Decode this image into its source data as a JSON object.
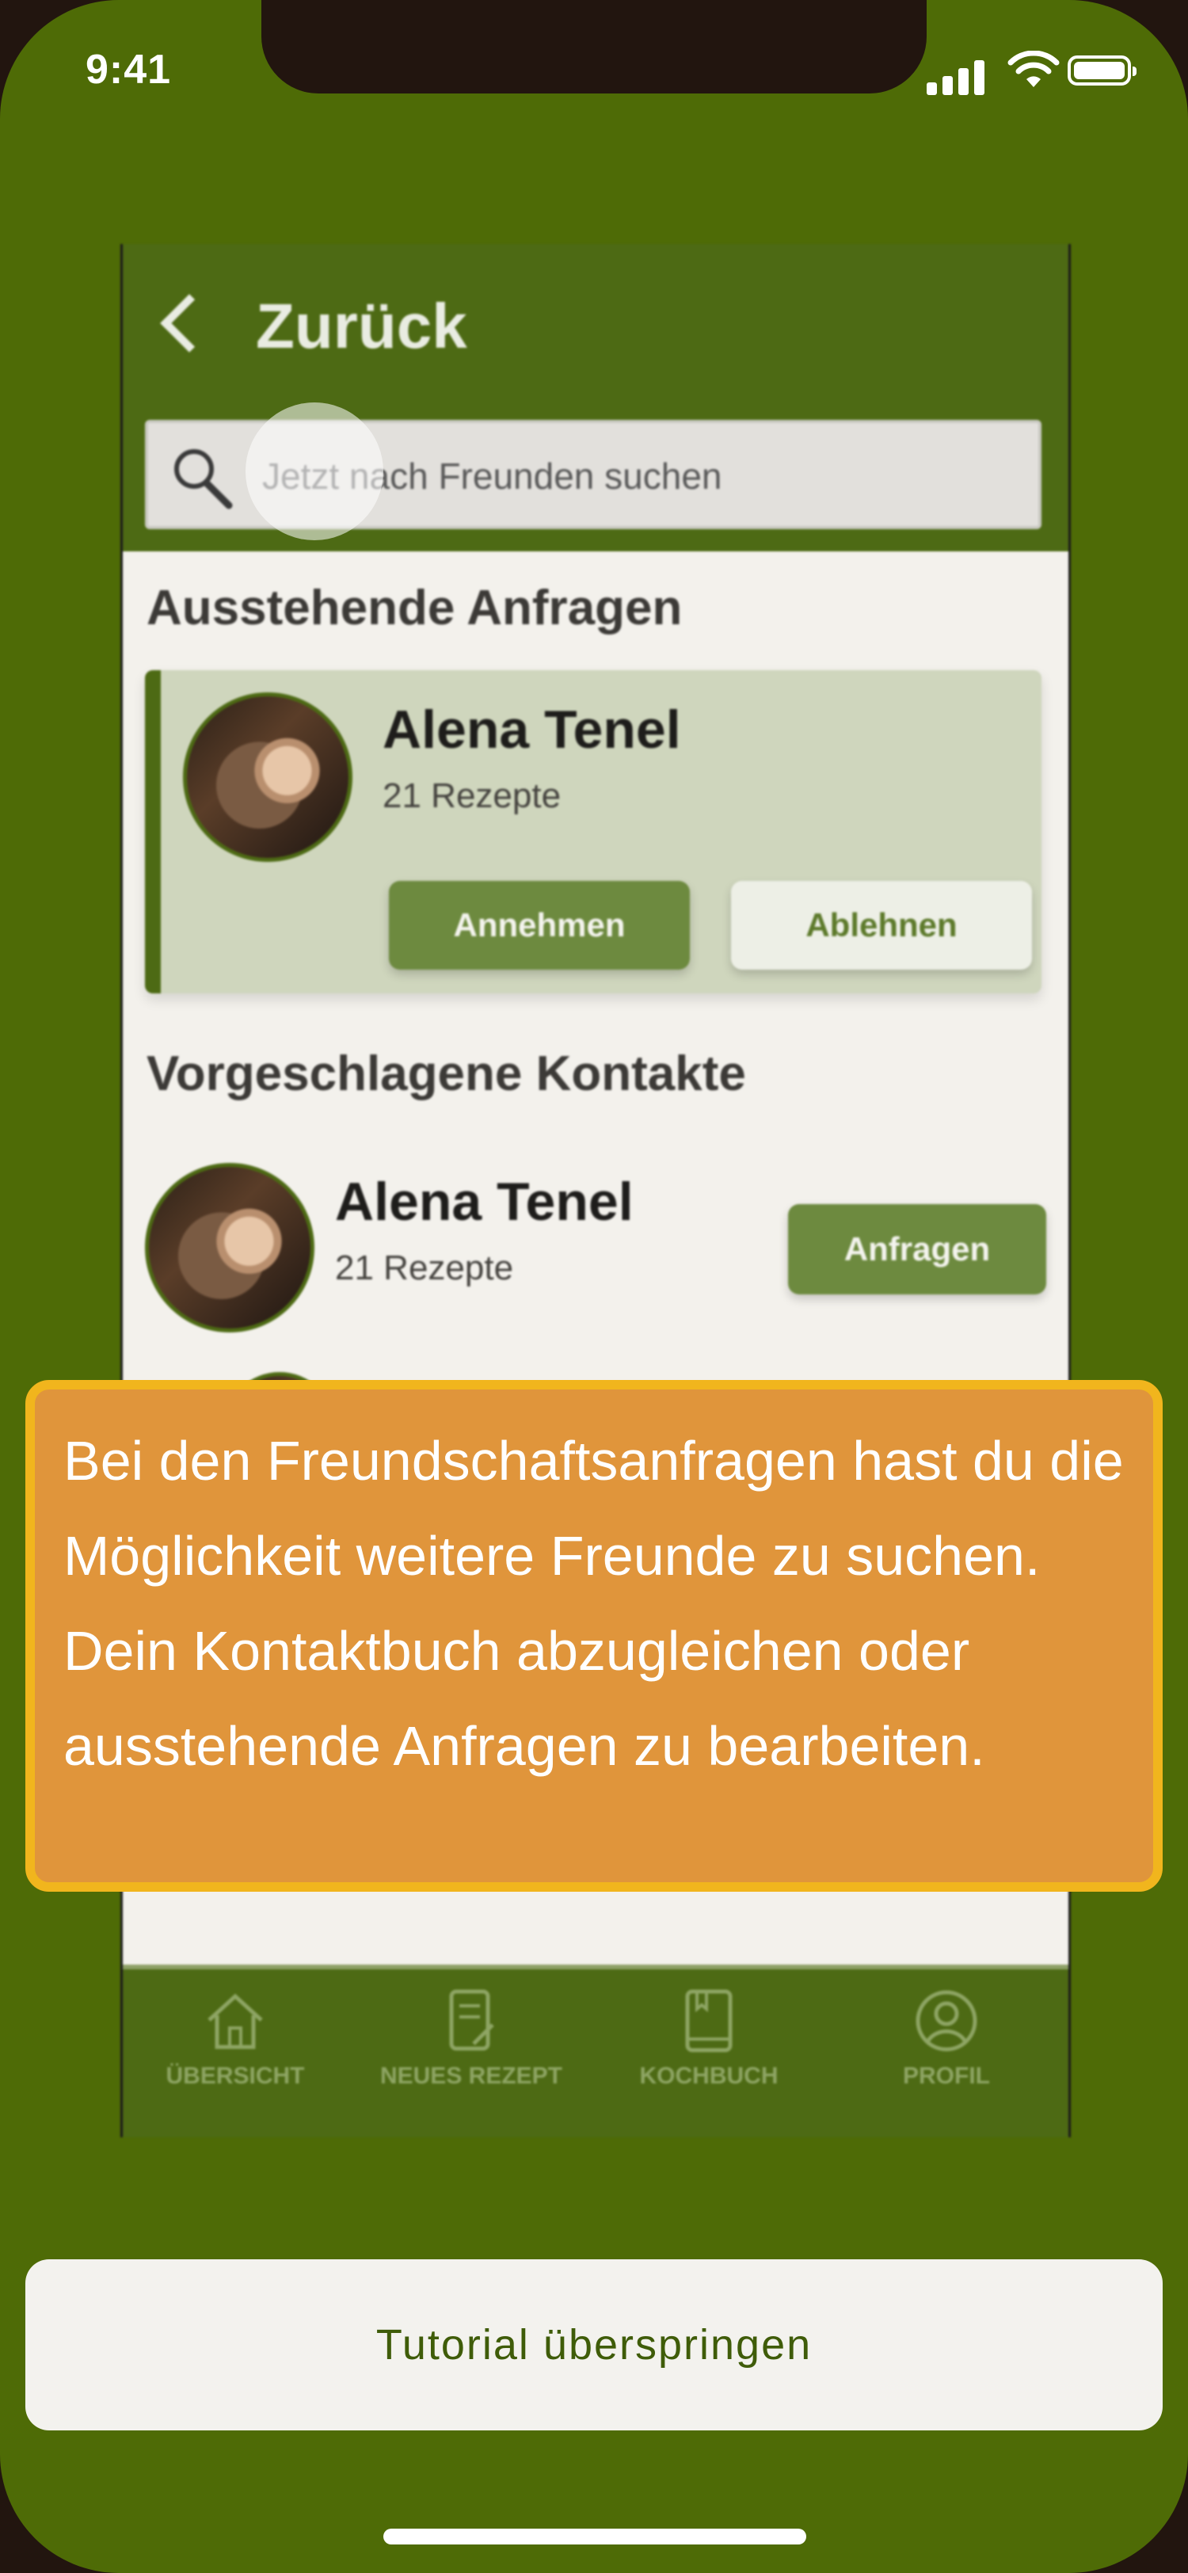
{
  "status_bar": {
    "time": "9:41"
  },
  "app_screen": {
    "back_label": "Zurück",
    "search": {
      "placeholder": "Jetzt nach Freunden suchen"
    },
    "pending": {
      "title": "Ausstehende Anfragen",
      "card": {
        "name": "Alena Tenel",
        "subtitle": "21 Rezepte",
        "accept_label": "Annehmen",
        "decline_label": "Ablehnen"
      }
    },
    "suggested": {
      "title": "Vorgeschlagene Kontakte",
      "item": {
        "name": "Alena Tenel",
        "subtitle": "21 Rezepte",
        "request_label": "Anfragen"
      }
    },
    "tabs": [
      {
        "label": "ÜBERSICHT",
        "icon": "house-icon"
      },
      {
        "label": "NEUES REZEPT",
        "icon": "recipe-edit-icon"
      },
      {
        "label": "KOCHBUCH",
        "icon": "cookbook-icon"
      },
      {
        "label": "PROFIL",
        "icon": "profile-icon"
      }
    ]
  },
  "tutorial": {
    "message": "Bei den Freundschaftsanfragen hast du die Möglichkeit weitere Freunde zu suchen. Dein Kontaktbuch abzugleichen oder ausstehende Anfragen zu bearbeiten.",
    "skip_label": "Tutorial überspringen"
  },
  "colors": {
    "background": "#4e6b06",
    "app_header": "#4d6a14",
    "tooltip_fill": "#e0953b",
    "tooltip_border": "#f1b51d",
    "skip_text": "#3f5c09"
  }
}
